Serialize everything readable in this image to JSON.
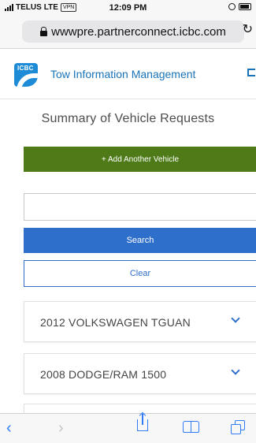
{
  "status_bar": {
    "carrier": "TELUS",
    "network": "LTE",
    "vpn": "VPN",
    "time": "12:09 PM"
  },
  "browser": {
    "url": "wwwpre.partnerconnect.icbc.com"
  },
  "header": {
    "logo_text": "ICBC",
    "title": "Tow Information Management",
    "colors": {
      "logo": "#1d8bd6",
      "title": "#1a73b8"
    }
  },
  "page": {
    "title": "Summary of Vehicle Requests"
  },
  "actions": {
    "add_vehicle_label": "+ Add Another Vehicle",
    "search_placeholder": "",
    "search_label": "Search",
    "clear_label": "Clear",
    "colors": {
      "add": "#4e7b18",
      "search": "#2f6fcc"
    }
  },
  "vehicles": [
    {
      "label": "2012 VOLKSWAGEN TGUAN"
    },
    {
      "label": "2008 DODGE/RAM 1500"
    },
    {
      "label": ""
    }
  ],
  "toolbar": {
    "icons": [
      "back-icon",
      "forward-icon",
      "share-icon",
      "bookmarks-icon",
      "tabs-icon"
    ]
  }
}
